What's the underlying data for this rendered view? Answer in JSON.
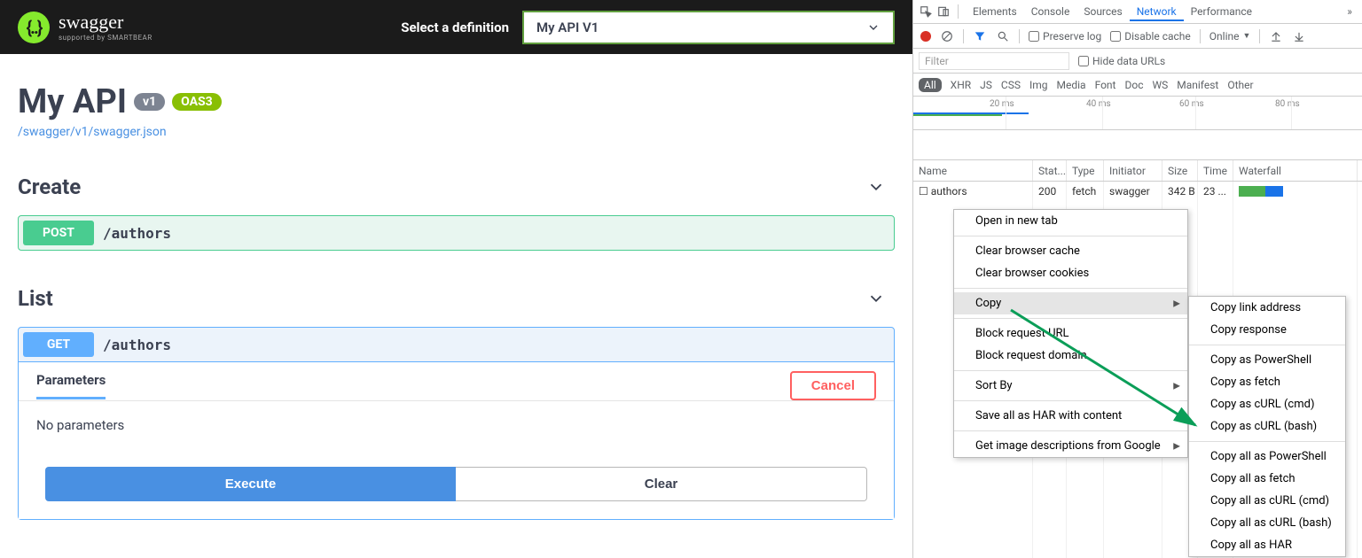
{
  "topbar": {
    "logo_text": "swagger",
    "logo_sub": "supported by SMARTBEAR",
    "select_label": "Select a definition",
    "select_value": "My API V1"
  },
  "api": {
    "title": "My API",
    "version_badge": "v1",
    "oas_badge": "OAS3",
    "def_link": "/swagger/v1/swagger.json"
  },
  "tags": {
    "create": "Create",
    "list": "List"
  },
  "ops": {
    "post_method": "POST",
    "post_path": "/authors",
    "get_method": "GET",
    "get_path": "/authors",
    "parameters_label": "Parameters",
    "cancel": "Cancel",
    "no_params": "No parameters",
    "execute": "Execute",
    "clear": "Clear"
  },
  "devtools": {
    "tabs": [
      "Elements",
      "Console",
      "Sources",
      "Network",
      "Performance"
    ],
    "active_tab": "Network",
    "preserve_log": "Preserve log",
    "disable_cache": "Disable cache",
    "online": "Online",
    "filter_placeholder": "Filter",
    "hide_urls": "Hide data URLs",
    "filter_types": [
      "All",
      "XHR",
      "JS",
      "CSS",
      "Img",
      "Media",
      "Font",
      "Doc",
      "WS",
      "Manifest",
      "Other"
    ],
    "ticks": [
      "20 ms",
      "40 ms",
      "60 ms",
      "80 ms"
    ],
    "cols": [
      "Name",
      "Stat...",
      "Type",
      "Initiator",
      "Size",
      "Time",
      "Waterfall"
    ],
    "row": {
      "name": "authors",
      "status": "200",
      "type": "fetch",
      "initiator": "swagger",
      "size": "342 B",
      "time": "23 ..."
    },
    "ctx1": [
      "Open in new tab",
      "",
      "Clear browser cache",
      "Clear browser cookies",
      "",
      "Copy",
      "",
      "Block request URL",
      "Block request domain",
      "",
      "Sort By",
      "",
      "Save all as HAR with content",
      "",
      "Get image descriptions from Google"
    ],
    "ctx1_submenu_items": [
      "Copy",
      "Sort By",
      "Get image descriptions from Google"
    ],
    "ctx1_highlight": "Copy",
    "ctx2": [
      "Copy link address",
      "Copy response",
      "",
      "Copy as PowerShell",
      "Copy as fetch",
      "Copy as cURL (cmd)",
      "Copy as cURL (bash)",
      "",
      "Copy all as PowerShell",
      "Copy all as fetch",
      "Copy all as cURL (cmd)",
      "Copy all as cURL (bash)",
      "Copy all as HAR"
    ]
  }
}
